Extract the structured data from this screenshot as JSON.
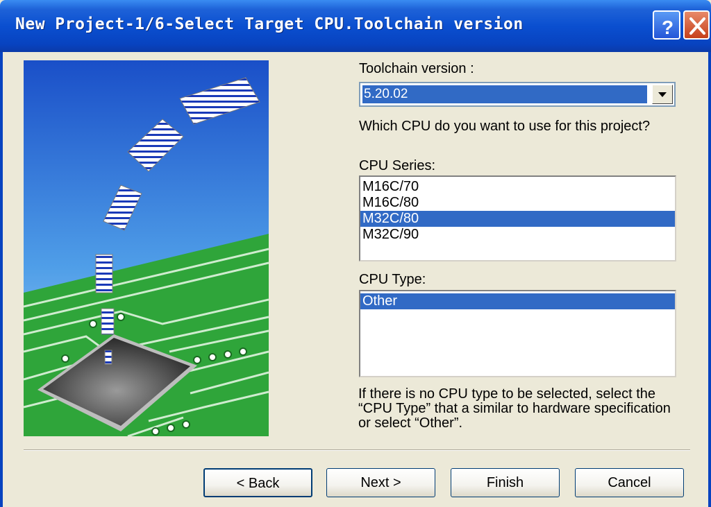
{
  "window": {
    "title": "New Project-1/6-Select Target CPU.Toolchain version"
  },
  "titlebar": {
    "help_icon": "help-icon",
    "close_icon": "close-icon"
  },
  "toolchain": {
    "label": "Toolchain version :",
    "selected": "5.20.02"
  },
  "question": "Which CPU do you want to use for this project?",
  "cpu_series": {
    "label": "CPU Series:",
    "items": [
      "M16C/70",
      "M16C/80",
      "M32C/80",
      "M32C/90"
    ],
    "selected_index": 2
  },
  "cpu_type": {
    "label": "CPU Type:",
    "items": [
      "Other"
    ],
    "selected_index": 0
  },
  "note": "If there is no CPU type to be selected, select the “CPU Type” that a similar to hardware specification or select “Other”.",
  "buttons": {
    "back": "< Back",
    "next": "Next >",
    "finish": "Finish",
    "cancel": "Cancel"
  },
  "colors": {
    "selection": "#316ac5",
    "dialog_bg": "#ece9d8",
    "titlebar": "#0a4fd0"
  }
}
